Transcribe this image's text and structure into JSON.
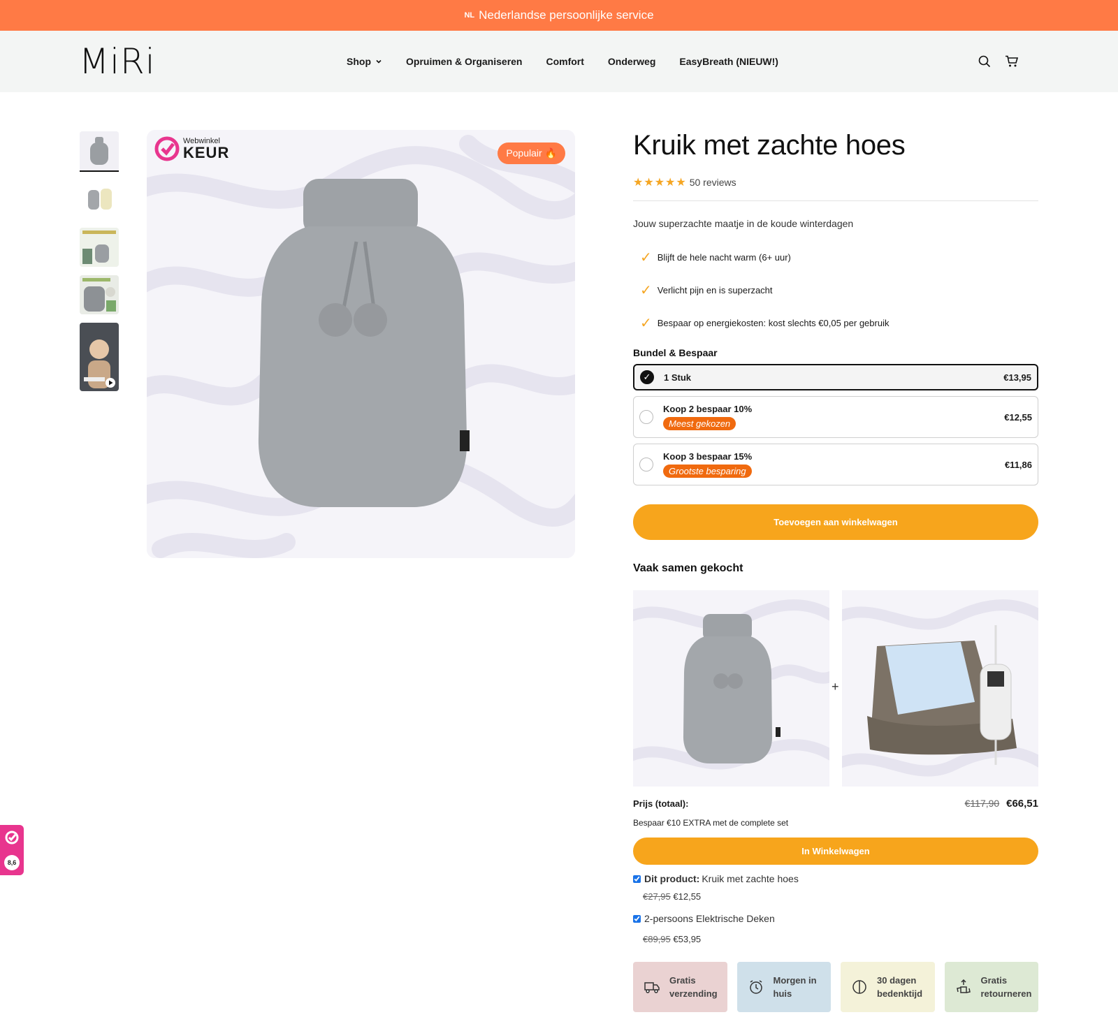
{
  "announcement": {
    "flag": "NL",
    "text": "Nederlandse persoonlijke service"
  },
  "header": {
    "logo": "MiRi",
    "nav": [
      "Shop",
      "Opruimen & Organiseren",
      "Comfort",
      "Onderweg",
      "EasyBreath (NIEUW!)"
    ]
  },
  "gallery": {
    "keur_small": "Webwinkel",
    "keur_big": "KEUR",
    "badge": "Populair 🔥"
  },
  "product": {
    "title": "Kruik met zachte hoes",
    "stars": "★★★★★",
    "reviews": "50 reviews",
    "subtitle": "Jouw superzachte maatje in de koude winterdagen",
    "bullets": [
      "Blijft de hele nacht warm (6+ uur)",
      "Verlicht pijn en is superzacht",
      "Bespaar op energiekosten: kost slechts €0,05 per gebruik"
    ],
    "bundle_title": "Bundel & Bespaar",
    "options": [
      {
        "label": "1 Stuk",
        "tag": "",
        "price": "€13,95"
      },
      {
        "label": "Koop 2 bespaar 10%",
        "tag": "Meest gekozen",
        "price": "€12,55"
      },
      {
        "label": "Koop 3 bespaar 15%",
        "tag": "Grootste besparing",
        "price": "€11,86"
      }
    ],
    "add_to_cart": "Toevoegen aan winkelwagen"
  },
  "fbt": {
    "title": "Vaak samen gekocht",
    "plus": "+",
    "total_label": "Prijs (totaal):",
    "old_total": "€117,90",
    "new_total": "€66,51",
    "save_note": "Bespaar €10 EXTRA met de complete set",
    "cart_button": "In Winkelwagen",
    "items": [
      {
        "prefix": "Dit product:",
        "name": "Kruik met zachte hoes",
        "old": "€27,95",
        "new": "€12,55"
      },
      {
        "prefix": "",
        "name": "2-persoons Elektrische Deken",
        "old": "€89,95",
        "new": "€53,95"
      }
    ]
  },
  "perks": [
    {
      "line1": "Gratis",
      "line2": "verzending",
      "icon": "truck-icon",
      "bg": "#ead2d2"
    },
    {
      "line1": "Morgen in",
      "line2": "huis",
      "icon": "clock-icon",
      "bg": "#cfe0ea"
    },
    {
      "line1": "30 dagen",
      "line2": "bedenktijd",
      "icon": "shield-icon",
      "bg": "#f4f2d9"
    },
    {
      "line1": "Gratis",
      "line2": "retourneren",
      "icon": "recycle-icon",
      "bg": "#dde9d4"
    }
  ],
  "side_badge": {
    "score": "8,6"
  },
  "colors": {
    "accent": "#ff7a45",
    "button": "#f7a51c",
    "tag": "#f06a0f",
    "keur": "#e8358e"
  }
}
